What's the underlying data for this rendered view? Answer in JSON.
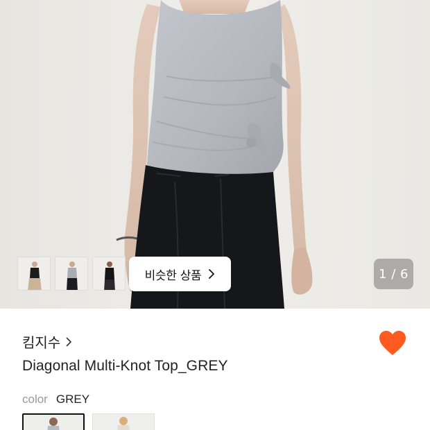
{
  "gallery": {
    "counter": "1 / 6",
    "similar_button_label": "비슷한 상품",
    "thumbnails": [
      "thumbnail-black-top",
      "thumbnail-grey-top",
      "thumbnail-black-knot-top"
    ]
  },
  "product": {
    "brand": "킴지수",
    "name": "Diagonal Multi-Knot Top_GREY",
    "liked": true
  },
  "option": {
    "label": "color",
    "value": "GREY",
    "swatches": [
      "grey",
      "ivory"
    ]
  },
  "colors": {
    "like": "#ff5a1f",
    "top_grey": "#b9bcc2",
    "skirt_black": "#16171a"
  },
  "icons": {
    "brand_chevron": "chevron-right-icon",
    "similar_chevron": "chevron-right-icon",
    "like": "heart-icon"
  }
}
